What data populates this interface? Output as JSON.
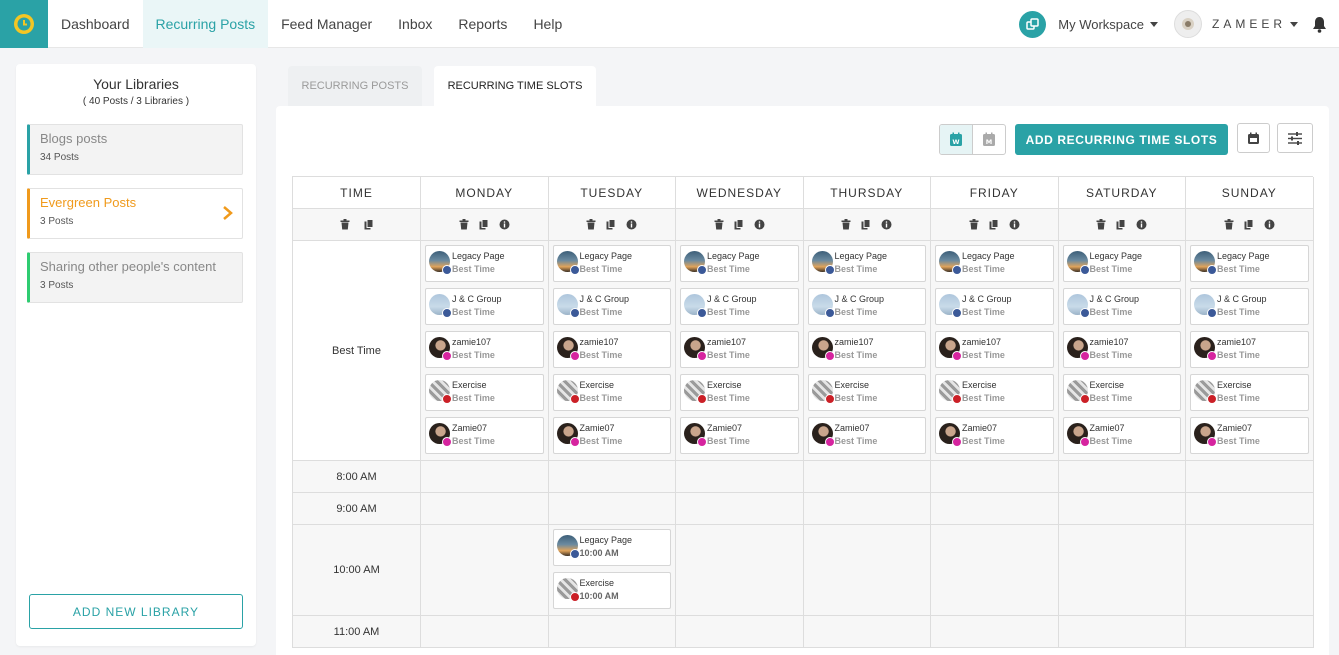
{
  "nav": {
    "items": [
      "Dashboard",
      "Recurring Posts",
      "Feed Manager",
      "Inbox",
      "Reports",
      "Help"
    ],
    "active_index": 1,
    "workspace": "My Workspace",
    "user": "ZAMEER"
  },
  "sidebar": {
    "title": "Your Libraries",
    "subtitle": "( 40 Posts / 3 Libraries )",
    "libraries": [
      {
        "name": "Blogs posts",
        "count": "34 Posts",
        "accent": "#2aa2a6"
      },
      {
        "name": "Evergreen Posts",
        "count": "3 Posts",
        "accent": "#f09a1c",
        "active": true
      },
      {
        "name": "Sharing other people's content",
        "count": "3 Posts",
        "accent": "#2ecc71"
      }
    ],
    "add_button": "ADD NEW LIBRARY"
  },
  "tabs": {
    "recurring_posts": "RECURRING POSTS",
    "recurring_time_slots": "RECURRING TIME SLOTS"
  },
  "toolbar": {
    "week_toggle": "W",
    "month_toggle": "M",
    "add_slots": "ADD RECURRING TIME SLOTS"
  },
  "grid": {
    "time_header": "TIME",
    "days": [
      "MONDAY",
      "TUESDAY",
      "WEDNESDAY",
      "THURSDAY",
      "FRIDAY",
      "SATURDAY",
      "SUNDAY"
    ],
    "best_label": "Best Time",
    "best_cards": [
      {
        "name": "Legacy Page",
        "time": "Best Time",
        "avatar": "legacy",
        "network": "fb"
      },
      {
        "name": "J & C Group",
        "time": "Best Time",
        "avatar": "jc",
        "network": "fb"
      },
      {
        "name": "zamie107",
        "time": "Best Time",
        "avatar": "zamie",
        "network": "ig"
      },
      {
        "name": "Exercise",
        "time": "Best Time",
        "avatar": "exercise",
        "network": "pin"
      },
      {
        "name": "Zamie07",
        "time": "Best Time",
        "avatar": "zamie",
        "network": "ig"
      }
    ],
    "hours": [
      "8:00 AM",
      "9:00 AM",
      "10:00 AM",
      "11:00 AM"
    ],
    "ten_am_cards": [
      {
        "name": "Legacy Page",
        "time": "10:00 AM",
        "avatar": "legacy",
        "network": "fb"
      },
      {
        "name": "Exercise",
        "time": "10:00 AM",
        "avatar": "exercise",
        "network": "pin"
      }
    ]
  },
  "colors": {
    "primary": "#2aa2a6",
    "evergreen": "#f09a1c",
    "sharing": "#2ecc71"
  }
}
